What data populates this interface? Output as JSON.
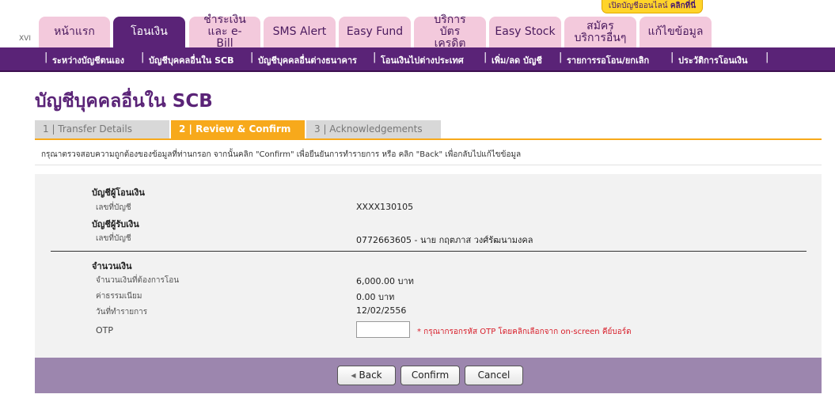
{
  "version_label": "XVI",
  "open_account_banner": {
    "prefix": "เปิดบัญชีออนไลน์",
    "link": "คลิกที่นี่"
  },
  "tabs": [
    {
      "label": "หน้าแรก",
      "active": false
    },
    {
      "label": "โอนเงิน",
      "active": true
    },
    {
      "label": "ชำระเงิน และ e-Bill",
      "active": false
    },
    {
      "label": "SMS Alert",
      "active": false
    },
    {
      "label": "Easy Fund",
      "active": false
    },
    {
      "label": "บริการ บัตรเครดิต",
      "active": false
    },
    {
      "label": "Easy Stock",
      "active": false
    },
    {
      "label": "สมัคร บริการอื่นๆ",
      "active": false
    },
    {
      "label": "แก้ไขข้อมูล",
      "active": false
    }
  ],
  "subnav": [
    "ระหว่างบัญชีตนเอง",
    "บัญชีบุคคลอื่นใน SCB",
    "บัญชีบุคคลอื่นต่างธนาคาร",
    "โอนเงินไปต่างประเทศ",
    "เพิ่ม/ลด บัญชี",
    "รายการรอโอน/ยกเลิก",
    "ประวัติการโอนเงิน"
  ],
  "page_title": "บัญชีบุคคลอื่นใน SCB",
  "steps": [
    {
      "label": "1 | Transfer Details",
      "active": false
    },
    {
      "label": "2 | Review & Confirm",
      "active": true
    },
    {
      "label": "3 | Acknowledgements",
      "active": false
    }
  ],
  "instruction": "กรุณาตรวจสอบความถูกต้องของข้อมูลที่ท่านกรอก จากนั้นคลิก \"Confirm\" เพื่อยืนยันการทำรายการ หรือ คลิก \"Back\" เพื่อกลับไปแก้ไขข้อมูล",
  "from_account": {
    "heading": "บัญชีผู้โอนเงิน",
    "label": "เลขที่บัญชี",
    "value": "XXXX130105"
  },
  "to_account": {
    "heading": "บัญชีผู้รับเงิน",
    "label": "เลขที่บัญชี",
    "value": "0772663605 - นาย กฤตภาส วงศ์รัฒนามงคล"
  },
  "amount_section": {
    "heading": "จำนวนเงิน",
    "transfer_amount_label": "จำนวนเงินที่ต้องการโอน",
    "transfer_amount_value": "6,000.00  บาท",
    "fee_label": "ค่าธรรมเนียม",
    "fee_value": "0.00  บาท",
    "date_label": "วันที่ทำรายการ",
    "date_value": "12/02/2556"
  },
  "otp": {
    "label": "OTP",
    "value": "",
    "note": "* กรุณากรอกรหัส OTP โดยคลิกเลือกจาก on-screen คีย์บอร์ด"
  },
  "buttons": {
    "back": "Back",
    "confirm": "Confirm",
    "cancel": "Cancel"
  },
  "colors": {
    "brand": "#5a2377",
    "accent": "#f7a91b",
    "tab_inactive": "#f3c9dc",
    "footer": "#9c86ae",
    "note_red": "#d8202c"
  }
}
